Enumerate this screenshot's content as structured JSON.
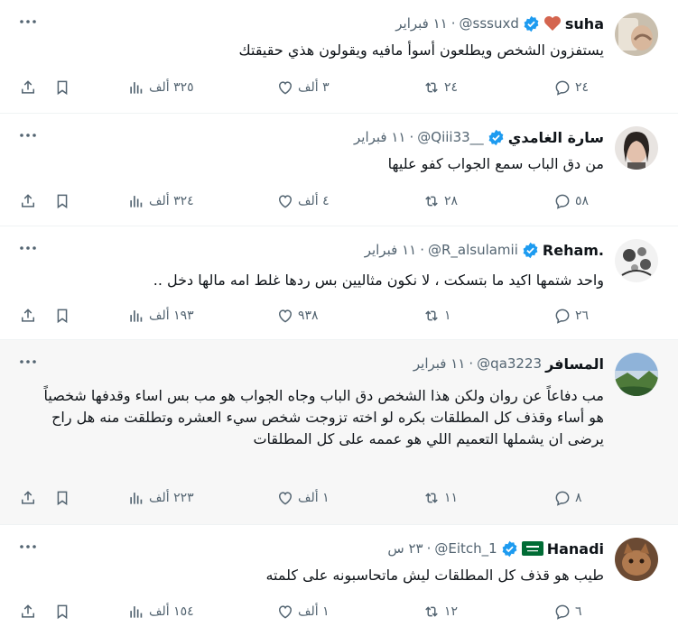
{
  "colors": {
    "accent": "#1d9bf0",
    "muted": "#536471",
    "text": "#0f1419",
    "heart": "#d4654f",
    "flag": "#006c35"
  },
  "tweets": [
    {
      "name": "suha",
      "emoji": "heart",
      "verified": true,
      "handle": "@sssuxd",
      "time": "١١ فبراير",
      "text": "يستفزون الشخص ويطلعون أسوأ مافيه ويقولون هذي حقيقتك",
      "replies": "٢٤",
      "reposts": "٢٤",
      "likes": "٣ ألف",
      "views": "٣٢٥ ألف"
    },
    {
      "name": "سارة الغامدي",
      "emoji": "",
      "verified": true,
      "handle": "@Qiii33__",
      "time": "١١ فبراير",
      "text": "من دق الباب سمع الجواب كفو عليها",
      "replies": "٥٨",
      "reposts": "٢٨",
      "likes": "٤ ألف",
      "views": "٣٢٤ ألف"
    },
    {
      "name": "Reham.",
      "emoji": "",
      "verified": true,
      "handle": "@R_alsulamii",
      "time": "١١ فبراير",
      "text": "واحد شتمها اكيد ما بتسكت ، لا نكون مثاليين بس ردها غلط امه مالها دخل ..",
      "replies": "٢٦",
      "reposts": "١",
      "likes": "٩٣٨",
      "views": "١٩٣ ألف"
    },
    {
      "name": "المسافر",
      "emoji": "",
      "verified": false,
      "handle": "@qa3223",
      "time": "١١ فبراير",
      "text": "مب دفاعاً عن روان ولكن هذا الشخص دق الباب وجاه الجواب هو مب بس اساء وقدفها شخصياً هو أساء وقذف كل المطلقات بكره لو اخته تزوجت شخص سيء العشره وتطلقت منه هل راح يرضى ان يشملها التعميم اللي هو عممه على كل المطلقات",
      "replies": "٨",
      "reposts": "١١",
      "likes": "١ ألف",
      "views": "٢٢٣ ألف"
    },
    {
      "name": "Hanadi",
      "emoji": "flag",
      "verified": true,
      "handle": "@Eitch_1",
      "time": "٢٣ س",
      "text": "طيب هو قذف كل المطلقات ليش ماتحاسبونه على كلمته",
      "replies": "٦",
      "reposts": "١٢",
      "likes": "١ ألف",
      "views": "١٥٤ ألف"
    }
  ]
}
